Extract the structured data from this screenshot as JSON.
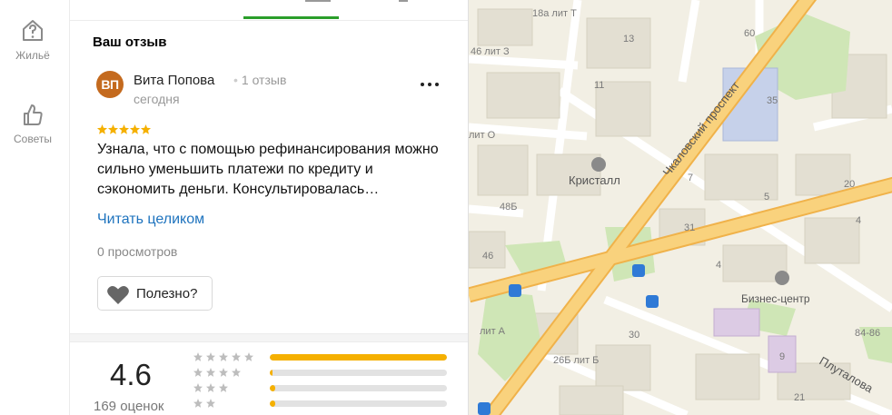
{
  "rail": [
    {
      "label": "Жильё",
      "icon": "house-question-icon"
    },
    {
      "label": "Советы",
      "icon": "thumbs-up-icon"
    }
  ],
  "review": {
    "heading": "Ваш отзыв",
    "avatar_initials": "ВП",
    "avatar_color": "#c46a1e",
    "author": "Вита Попова",
    "author_reviews": "1 отзыв",
    "date": "сегодня",
    "stars": 5,
    "text": "Узнала, что с помощью рефинансирования можно сильно уменьшить платежи по кредиту и сэкономить деньги. Консультировалась…",
    "read_more": "Читать целиком",
    "views": "0 просмотров",
    "helpful_label": "Полезно?"
  },
  "summary": {
    "rating": "4.6",
    "count": "169 оценок",
    "distribution": [
      {
        "stars": 5,
        "fraction": 1.0
      },
      {
        "stars": 4,
        "fraction": 0.01
      },
      {
        "stars": 3,
        "fraction": 0.03
      },
      {
        "stars": 2,
        "fraction": 0.03
      }
    ]
  },
  "map": {
    "street_labels": [
      "Чкаловский проспект",
      "Плуталова"
    ],
    "poi_labels": [
      "Кристалл",
      "Бизнес-центр"
    ],
    "house_numbers": [
      "18а лит Т",
      "13",
      "60",
      "46 лит З",
      "11",
      "35",
      "лит О",
      "7",
      "5",
      "20",
      "48Б",
      "31",
      "46",
      "4",
      "4",
      "лит А",
      "30",
      "84-86",
      "26Б лит Б",
      "9",
      "21"
    ]
  },
  "colors": {
    "accent_green": "#2a9e2a",
    "link_blue": "#1e73be",
    "star_gold": "#f5b000",
    "road_orange": "#f7c15e"
  }
}
